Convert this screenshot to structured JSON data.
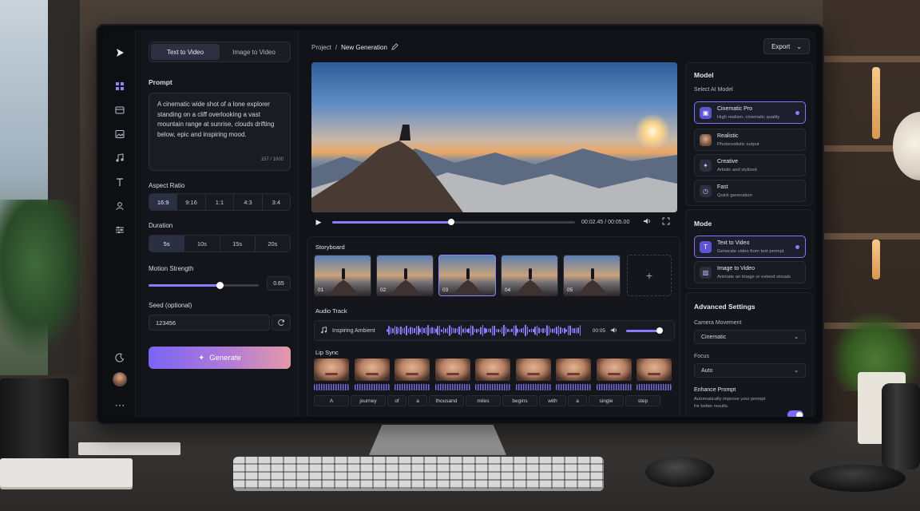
{
  "header": {
    "breadcrumb_root": "Project",
    "breadcrumb_sep": "/",
    "breadcrumb_current": "New Generation",
    "export_label": "Export"
  },
  "input_mode": {
    "tabs": [
      {
        "label": "Text to Video",
        "active": true
      },
      {
        "label": "Image to Video",
        "active": false
      }
    ]
  },
  "prompt": {
    "label": "Prompt",
    "text": "A cinematic wide shot of a lone explorer standing on a cliff overlooking a vast mountain range at sunrise, clouds drifting below, epic and inspiring mood.",
    "counter": "157 / 1000"
  },
  "aspect_ratio": {
    "label": "Aspect Ratio",
    "options": [
      "16:9",
      "9:16",
      "1:1",
      "4:3",
      "3:4"
    ],
    "selected": "16:9"
  },
  "duration": {
    "label": "Duration",
    "options": [
      "5s",
      "10s",
      "15s",
      "20s"
    ],
    "selected": "5s"
  },
  "motion_strength": {
    "label": "Motion Strength",
    "value": 0.65,
    "value_label": "0.65"
  },
  "seed": {
    "label": "Seed (optional)",
    "value": "123456"
  },
  "generate_label": "Generate",
  "player": {
    "current_time": "00:02.45",
    "total_time": "00:05.00",
    "timecode": "00:02.45 / 00:05.00",
    "progress": 0.49
  },
  "storyboard": {
    "title": "Storyboard",
    "frames": [
      "01",
      "02",
      "03",
      "04",
      "05"
    ],
    "selected_index": 2
  },
  "audio": {
    "title": "Audio Track",
    "track_name": "Inspiring Ambient",
    "duration": "00:05",
    "volume": 0.95
  },
  "lip_sync": {
    "title": "Lip Sync",
    "words": [
      "A",
      "journey",
      "of",
      "a",
      "thousand",
      "miles",
      "begins",
      "with",
      "a",
      "single",
      "step"
    ]
  },
  "model": {
    "title": "Model",
    "subtitle": "Select AI Model",
    "options": [
      {
        "name": "Cinematic Pro",
        "desc": "High realism, cinematic quality",
        "icon": "film-icon",
        "selected": true
      },
      {
        "name": "Realistic",
        "desc": "Photorealistic output",
        "icon": "portrait-icon",
        "selected": false
      },
      {
        "name": "Creative",
        "desc": "Artistic and stylized",
        "icon": "sparkle-icon",
        "selected": false
      },
      {
        "name": "Fast",
        "desc": "Quick generation",
        "icon": "clock-icon",
        "selected": false
      }
    ]
  },
  "mode": {
    "title": "Mode",
    "options": [
      {
        "name": "Text to Video",
        "desc": "Generate video from text prompt",
        "icon": "text-icon",
        "selected": true
      },
      {
        "name": "Image to Video",
        "desc": "Animate an image or extend visuals",
        "icon": "image-icon",
        "selected": false
      }
    ]
  },
  "advanced": {
    "title": "Advanced Settings",
    "camera_label": "Camera Movement",
    "camera_value": "Cinematic",
    "focus_label": "Focus",
    "focus_value": "Auto",
    "enhance_label": "Enhance Prompt",
    "enhance_desc_1": "Automatically improve your prompt",
    "enhance_desc_2": "for better results.",
    "enhance_on": true
  },
  "colors": {
    "accent": "#8a7cff",
    "panel": "#15161c",
    "background": "#121318"
  }
}
